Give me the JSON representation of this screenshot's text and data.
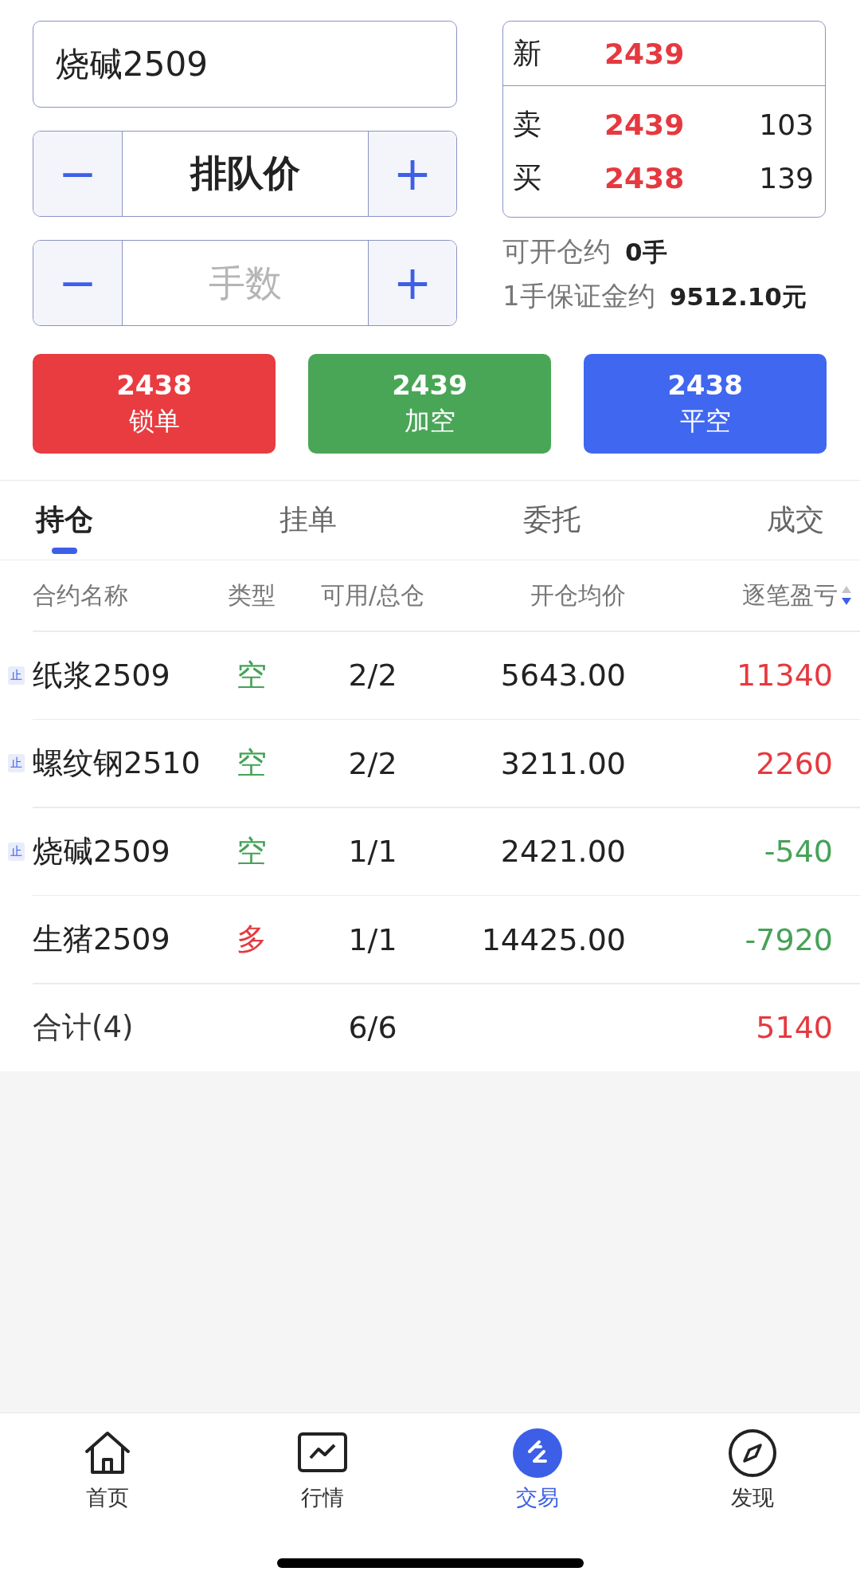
{
  "contract_field": {
    "value": "烧碱2509"
  },
  "price_stepper": {
    "minus": "−",
    "value": "排队价",
    "plus": "+"
  },
  "qty_stepper": {
    "minus": "−",
    "placeholder": "手数",
    "plus": "+"
  },
  "quote": {
    "last": {
      "label": "新",
      "price": "2439"
    },
    "levels": [
      {
        "label": "卖",
        "price": "2439",
        "volume": "103"
      },
      {
        "label": "买",
        "price": "2438",
        "volume": "139"
      }
    ]
  },
  "info": [
    {
      "label": "可开仓约",
      "value": "0手"
    },
    {
      "label": "1手保证金约",
      "value": "9512.10元"
    }
  ],
  "actions": [
    {
      "price": "2438",
      "label": "锁单",
      "color": "#e83c41"
    },
    {
      "price": "2439",
      "label": "加空",
      "color": "#4aa657"
    },
    {
      "price": "2438",
      "label": "平空",
      "color": "#4067f0"
    }
  ],
  "tabs": [
    {
      "label": "持仓",
      "selected": true
    },
    {
      "label": "挂单",
      "selected": false
    },
    {
      "label": "委托",
      "selected": false
    },
    {
      "label": "成交",
      "selected": false
    }
  ],
  "table": {
    "columns": [
      "合约名称",
      "类型",
      "可用/总仓",
      "开仓均价",
      "逐笔盈亏"
    ],
    "rows": [
      {
        "badge": "止",
        "name": "纸浆2509",
        "type": {
          "text": "空",
          "color": "#46a257"
        },
        "available": "2/2",
        "avg_price": "5643.00",
        "pnl": {
          "text": "11340",
          "color": "#e5393f"
        }
      },
      {
        "badge": "止",
        "name": "螺纹钢2510",
        "type": {
          "text": "空",
          "color": "#46a257"
        },
        "available": "2/2",
        "avg_price": "3211.00",
        "pnl": {
          "text": "2260",
          "color": "#e5393f"
        }
      },
      {
        "badge": "止",
        "name": "烧碱2509",
        "type": {
          "text": "空",
          "color": "#46a257"
        },
        "available": "1/1",
        "avg_price": "2421.00",
        "pnl": {
          "text": "-540",
          "color": "#46a257"
        }
      },
      {
        "name": "生猪2509",
        "type": {
          "text": "多",
          "color": "#e5393f"
        },
        "available": "1/1",
        "avg_price": "14425.00",
        "pnl": {
          "text": "-7920",
          "color": "#46a257"
        }
      }
    ],
    "total": {
      "label": "合计(4)",
      "available": "6/6",
      "pnl": {
        "text": "5140",
        "color": "#e5393f"
      }
    }
  },
  "nav": [
    {
      "label": "首页",
      "kind": "home",
      "selected": false
    },
    {
      "label": "行情",
      "kind": "chart",
      "selected": false
    },
    {
      "label": "交易",
      "kind": "trade",
      "selected": true
    },
    {
      "label": "发现",
      "kind": "compass",
      "selected": false
    }
  ]
}
